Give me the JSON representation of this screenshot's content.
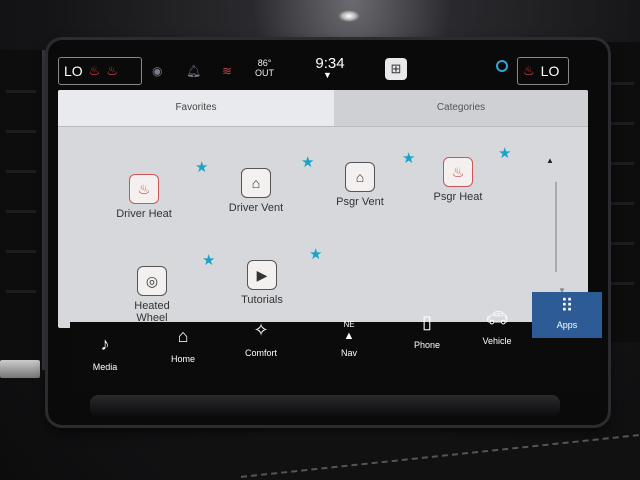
{
  "status_bar": {
    "left_temp": "LO",
    "outside_temp": "86°",
    "outside_label": "OUT",
    "time": "9:34",
    "right_temp": "LO"
  },
  "icons": {
    "seat_heat": "seat-heat-icon",
    "user": "user-icon",
    "bell": "bell-icon",
    "wifi": "wifi-icon",
    "apps": "apps-grid-icon",
    "alexa": "alexa-icon"
  },
  "tabs": {
    "favorites": "Favorites",
    "categories": "Categories"
  },
  "apps": [
    {
      "label": "Driver Heat"
    },
    {
      "label": "Driver Vent"
    },
    {
      "label": "Psgr Vent"
    },
    {
      "label": "Psgr Heat"
    },
    {
      "label": "Heated Wheel"
    },
    {
      "label": "Tutorials"
    }
  ],
  "nav": {
    "media": "Media",
    "home": "Home",
    "comfort": "Comfort",
    "nav_direction": "NE",
    "nav": "Nav",
    "phone": "Phone",
    "vehicle": "Vehicle",
    "apps": "Apps"
  },
  "colors": {
    "accent": "#2c5b95",
    "star": "#1aa3c8",
    "heat": "#e04a4a"
  }
}
